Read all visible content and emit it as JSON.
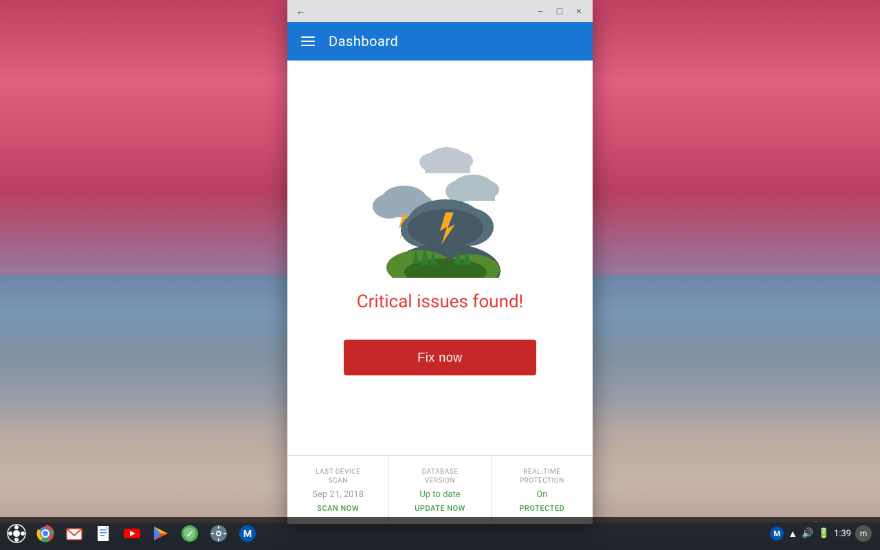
{
  "desktop": {
    "background_description": "sunset over ocean"
  },
  "window": {
    "title_bar": {
      "back_label": "←",
      "minimize_label": "−",
      "maximize_label": "□",
      "close_label": "×"
    },
    "header": {
      "title": "Dashboard",
      "menu_icon": "hamburger"
    },
    "content": {
      "critical_message": "Critical issues found!",
      "fix_button_label": "Fix now",
      "illustration_alt": "storm cloud illustration"
    },
    "status_bar": {
      "items": [
        {
          "label": "LAST DEVICE\nSCAN",
          "value": "Sep 21, 2018",
          "action": "SCAN NOW"
        },
        {
          "label": "DATABASE\nVERSION",
          "value": "Up to date",
          "value_class": "green",
          "action": "UPDATE NOW"
        },
        {
          "label": "REAL-TIME\nPROTECTION",
          "value": "On",
          "value_class": "green",
          "action": "PROTECTED"
        }
      ]
    }
  },
  "taskbar": {
    "time": "1:39",
    "icons": [
      {
        "name": "chrome-os-launcher",
        "symbol": "⬤"
      },
      {
        "name": "chrome-browser",
        "symbol": "⬤"
      },
      {
        "name": "gmail",
        "symbol": "⬤"
      },
      {
        "name": "docs",
        "symbol": "⬤"
      },
      {
        "name": "youtube",
        "symbol": "⬤"
      },
      {
        "name": "play",
        "symbol": "⬤"
      },
      {
        "name": "security",
        "symbol": "⬤"
      },
      {
        "name": "settings",
        "symbol": "⬤"
      },
      {
        "name": "malwarebytes",
        "symbol": "⬤"
      }
    ],
    "system_tray": {
      "malwarebytes": "M",
      "network": "↑",
      "volume": "▲",
      "battery": "▮",
      "time": "1:39",
      "account": "m"
    }
  },
  "colors": {
    "header_blue": "#1976d2",
    "critical_red": "#e53935",
    "fix_button_red": "#c62828",
    "green": "#43a047",
    "gray": "#9e9e9e"
  }
}
